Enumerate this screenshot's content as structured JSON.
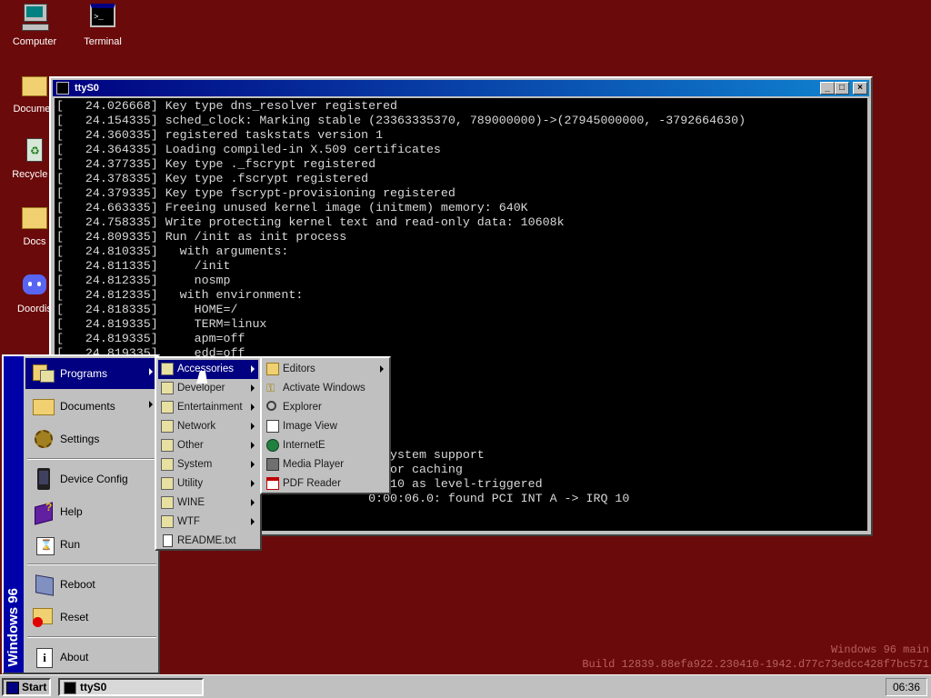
{
  "desktop": {
    "icons": [
      {
        "label": "Computer",
        "icon": "computer-icon"
      },
      {
        "label": "Terminal",
        "icon": "terminal-icon"
      },
      {
        "label": "Documen",
        "icon": "documents-folder-icon"
      },
      {
        "label": "Recycle B",
        "icon": "recycle-bin-icon"
      },
      {
        "label": "Docs",
        "icon": "folder-icon"
      },
      {
        "label": "Doordis",
        "icon": "discord-icon"
      }
    ]
  },
  "window": {
    "title": "ttyS0",
    "lines": [
      "[   24.026668] Key type dns_resolver registered",
      "[   24.154335] sched_clock: Marking stable (23363335370, 789000000)->(27945000000, -3792664630)",
      "[   24.360335] registered taskstats version 1",
      "[   24.364335] Loading compiled-in X.509 certificates",
      "[   24.377335] Key type ._fscrypt registered",
      "[   24.378335] Key type .fscrypt registered",
      "[   24.379335] Key type fscrypt-provisioning registered",
      "[   24.663335] Freeing unused kernel image (initmem) memory: 640K",
      "[   24.758335] Write protecting kernel text and read-only data: 10608k",
      "[   24.809335] Run /init as init process",
      "[   24.810335]   with arguments:",
      "[   24.811335]     /init",
      "[   24.812335]     nosmp",
      "[   24.812335]   with environment:",
      "[   24.818335]     HOME=/",
      "[   24.819335]     TERM=linux",
      "[   24.819335]     apm=off",
      "[   24.819335]     edd=off",
      "",
      "",
      "",
      "",
      "                                           :",
      "",
      "                                             system support",
      "                                             for caching",
      "                                           RQ 10 as level-triggered",
      "                                           0:00:06.0: found PCI INT A -> IRQ 10"
    ]
  },
  "start_menu": {
    "banner": "Windows 96",
    "items": [
      {
        "label": "Programs",
        "icon": "programs-icon",
        "submenu": true
      },
      {
        "label": "Documents",
        "icon": "documents-icon",
        "submenu": true
      },
      {
        "label": "Settings",
        "icon": "settings-icon",
        "submenu": false
      },
      {
        "label": "Device Config",
        "icon": "device-config-icon",
        "submenu": false
      },
      {
        "label": "Help",
        "icon": "help-book-icon",
        "submenu": false
      },
      {
        "label": "Run",
        "icon": "run-icon",
        "submenu": false
      },
      {
        "label": "Reboot",
        "icon": "reboot-icon",
        "submenu": false
      },
      {
        "label": "Reset",
        "icon": "reset-icon",
        "submenu": false
      },
      {
        "label": "About",
        "icon": "about-icon",
        "submenu": false
      }
    ]
  },
  "programs_menu": {
    "items": [
      {
        "label": "Accessories",
        "submenu": true
      },
      {
        "label": "Developer",
        "submenu": true
      },
      {
        "label": "Entertainment",
        "submenu": true
      },
      {
        "label": "Network",
        "submenu": true
      },
      {
        "label": "Other",
        "submenu": true
      },
      {
        "label": "System",
        "submenu": true
      },
      {
        "label": "Utility",
        "submenu": true
      },
      {
        "label": "WINE",
        "submenu": true
      },
      {
        "label": "WTF",
        "submenu": true
      },
      {
        "label": "README.txt",
        "submenu": false
      }
    ]
  },
  "accessories_menu": {
    "items": [
      {
        "label": "Editors",
        "icon": "folder-icon",
        "submenu": true
      },
      {
        "label": "Activate Windows",
        "icon": "key-icon",
        "submenu": false
      },
      {
        "label": "Explorer",
        "icon": "explorer-icon",
        "submenu": false
      },
      {
        "label": "Image View",
        "icon": "image-view-icon",
        "submenu": false
      },
      {
        "label": "InternetE",
        "icon": "globe-icon",
        "submenu": false
      },
      {
        "label": "Media Player",
        "icon": "media-player-icon",
        "submenu": false
      },
      {
        "label": "PDF Reader",
        "icon": "pdf-icon",
        "submenu": false
      }
    ]
  },
  "taskbar": {
    "start_label": "Start",
    "tasks": [
      {
        "label": "ttyS0"
      }
    ],
    "clock": "06:36"
  },
  "watermark": {
    "line1": "Windows 96 main",
    "line2": "Build 12839.88efa922.230410-1942.d77c73edcc428f7bc571"
  },
  "colors": {
    "desktop": "#6b0a0a",
    "titlebar": "#000080",
    "menu_highlight": "#000080",
    "chrome": "#c0c0c0"
  }
}
